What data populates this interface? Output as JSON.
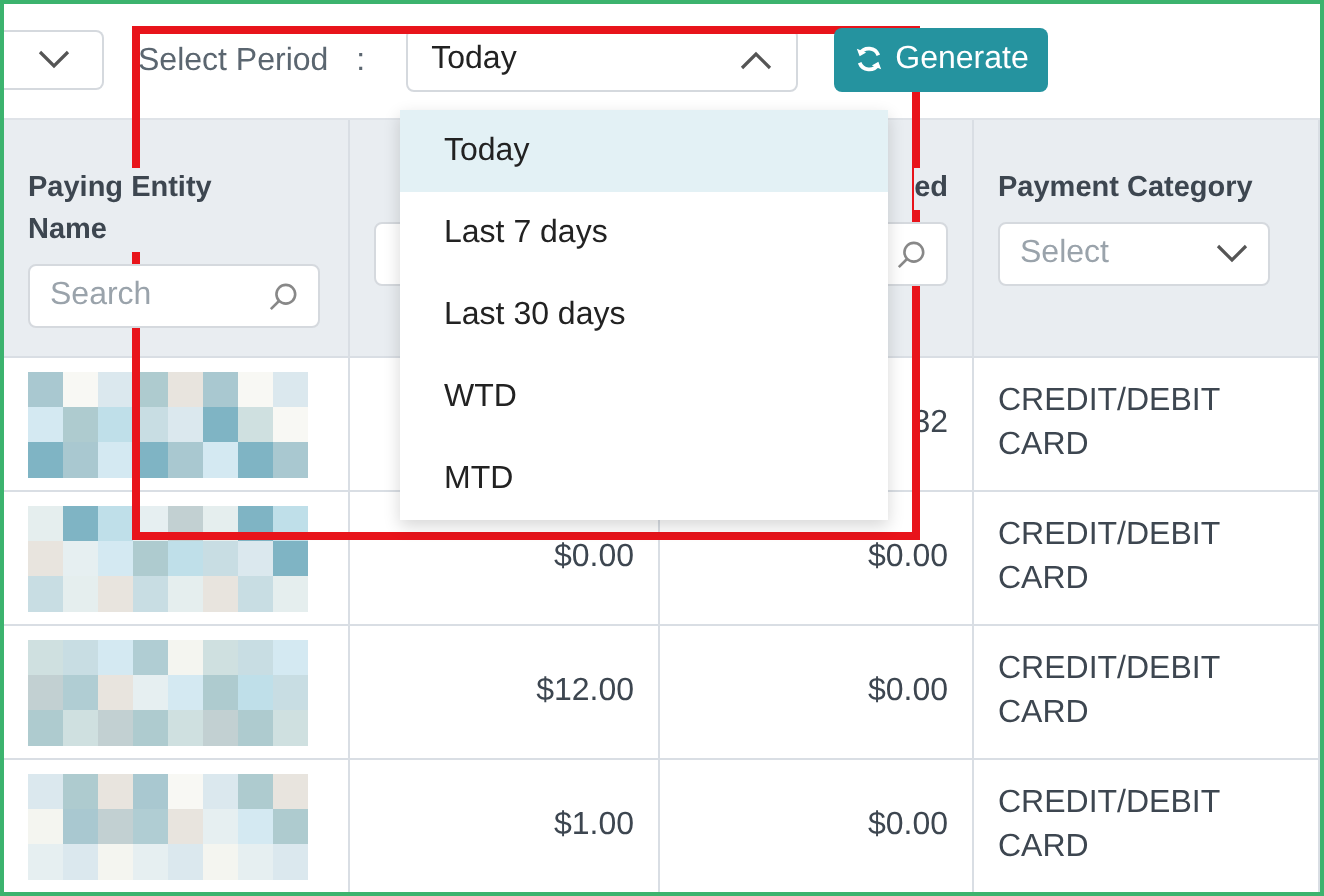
{
  "toolbar": {
    "previous_select": {
      "expanded": false
    },
    "period_label": "Select Period",
    "separator": ":",
    "period_select": {
      "value": "Today",
      "expanded": true
    },
    "generate_button": "Generate"
  },
  "period_options": [
    {
      "label": "Today",
      "selected": true
    },
    {
      "label": "Last 7 days",
      "selected": false
    },
    {
      "label": "Last 30 days",
      "selected": false
    },
    {
      "label": "WTD",
      "selected": false
    },
    {
      "label": "MTD",
      "selected": false
    }
  ],
  "table": {
    "columns": [
      {
        "title": "Paying Entity Name",
        "filter": {
          "kind": "search",
          "placeholder": "Search"
        }
      },
      {
        "filter": {
          "kind": "field"
        }
      },
      {
        "title": "ed",
        "filter": {
          "kind": "search"
        }
      },
      {
        "title": "Payment Category",
        "filter": {
          "kind": "select",
          "placeholder": "Select"
        }
      }
    ],
    "rows": [
      {
        "column_3": "32",
        "payment_category": "CREDIT/DEBIT CARD"
      },
      {
        "column_2": "$0.00",
        "column_3": "$0.00",
        "payment_category": "CREDIT/DEBIT CARD"
      },
      {
        "column_2": "$12.00",
        "column_3": "$0.00",
        "payment_category": "CREDIT/DEBIT CARD"
      },
      {
        "column_2": "$1.00",
        "column_3": "$0.00",
        "payment_category": "CREDIT/DEBIT CARD"
      }
    ]
  }
}
